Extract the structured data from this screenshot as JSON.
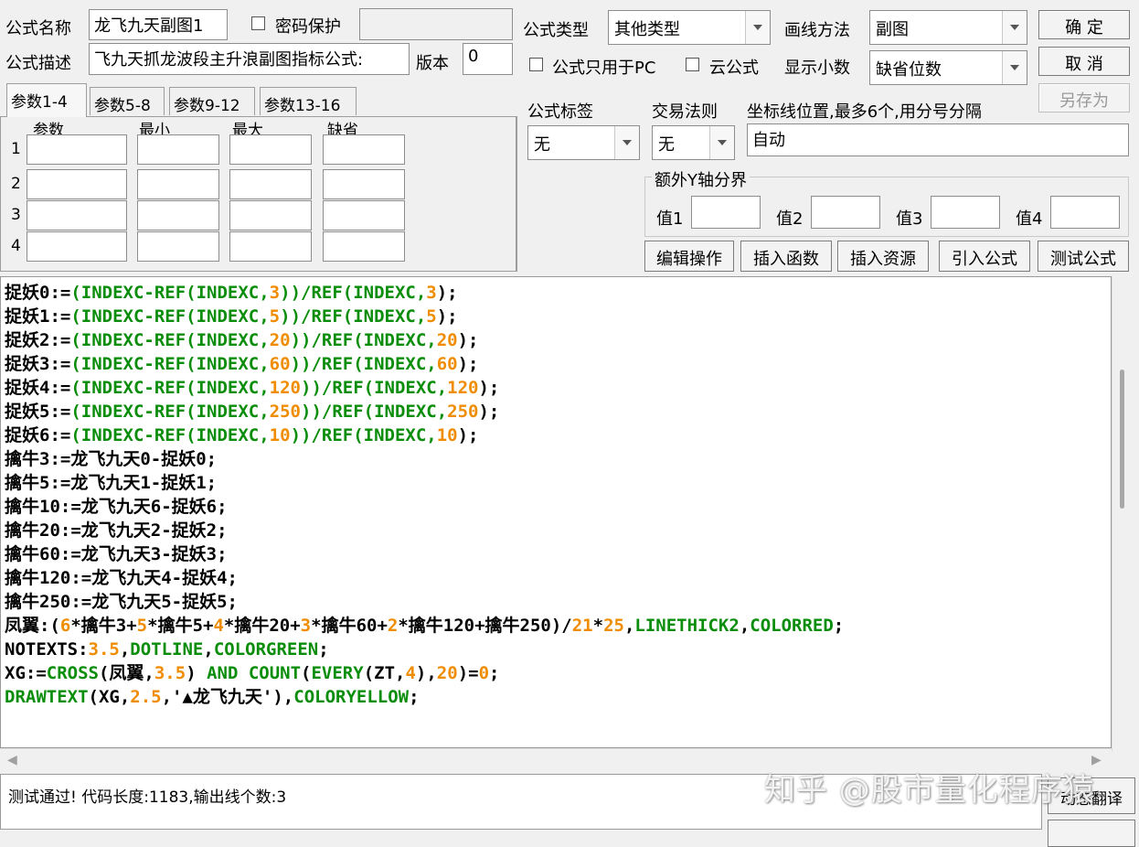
{
  "header": {
    "name_label": "公式名称",
    "name_value": "龙飞九天副图1",
    "password_label": "密码保护",
    "desc_label": "公式描述",
    "desc_value": "飞九天抓龙波段主升浪副图指标公式:",
    "version_label": "版本",
    "version_value": "0",
    "type_label": "公式类型",
    "type_value": "其他类型",
    "draw_label": "画线方法",
    "draw_value": "副图",
    "pc_only_label": "公式只用于PC",
    "cloud_label": "云公式",
    "decimals_label": "显示小数",
    "decimals_value": "缺省位数"
  },
  "buttons": {
    "ok": "确 定",
    "cancel": "取 消",
    "save_as": "另存为",
    "edit_ops": "编辑操作",
    "insert_func": "插入函数",
    "insert_res": "插入资源",
    "import_formula": "引入公式",
    "test_formula": "测试公式",
    "dynamic_translate": "动态翻译"
  },
  "tabs": [
    "参数1-4",
    "参数5-8",
    "参数9-12",
    "参数13-16"
  ],
  "param_headers": [
    "参数",
    "最小",
    "最大",
    "缺省"
  ],
  "param_rows": [
    "1",
    "2",
    "3",
    "4"
  ],
  "tag": {
    "label": "公式标签",
    "value": "无"
  },
  "trade_rule": {
    "label": "交易法则",
    "value": "无"
  },
  "axis": {
    "label": "坐标线位置,最多6个,用分号分隔",
    "value": "自动"
  },
  "extra_y": {
    "title": "额外Y轴分界",
    "labels": [
      "值1",
      "值2",
      "值3",
      "值4"
    ]
  },
  "code_lines": [
    [
      [
        "k",
        "捉妖0:="
      ],
      [
        "g",
        "(INDEXC-REF(INDEXC,"
      ],
      [
        "o",
        "3"
      ],
      [
        "g",
        "))/REF(INDEXC,"
      ],
      [
        "o",
        "3"
      ],
      [
        "k",
        ");"
      ]
    ],
    [
      [
        "k",
        "捉妖1:="
      ],
      [
        "g",
        "(INDEXC-REF(INDEXC,"
      ],
      [
        "o",
        "5"
      ],
      [
        "g",
        "))/REF(INDEXC,"
      ],
      [
        "o",
        "5"
      ],
      [
        "k",
        ");"
      ]
    ],
    [
      [
        "k",
        "捉妖2:="
      ],
      [
        "g",
        "(INDEXC-REF(INDEXC,"
      ],
      [
        "o",
        "20"
      ],
      [
        "g",
        "))/REF(INDEXC,"
      ],
      [
        "o",
        "20"
      ],
      [
        "k",
        ");"
      ]
    ],
    [
      [
        "k",
        "捉妖3:="
      ],
      [
        "g",
        "(INDEXC-REF(INDEXC,"
      ],
      [
        "o",
        "60"
      ],
      [
        "g",
        "))/REF(INDEXC,"
      ],
      [
        "o",
        "60"
      ],
      [
        "k",
        ");"
      ]
    ],
    [
      [
        "k",
        "捉妖4:="
      ],
      [
        "g",
        "(INDEXC-REF(INDEXC,"
      ],
      [
        "o",
        "120"
      ],
      [
        "g",
        "))/REF(INDEXC,"
      ],
      [
        "o",
        "120"
      ],
      [
        "k",
        ");"
      ]
    ],
    [
      [
        "k",
        "捉妖5:="
      ],
      [
        "g",
        "(INDEXC-REF(INDEXC,"
      ],
      [
        "o",
        "250"
      ],
      [
        "g",
        "))/REF(INDEXC,"
      ],
      [
        "o",
        "250"
      ],
      [
        "k",
        ");"
      ]
    ],
    [
      [
        "k",
        "捉妖6:="
      ],
      [
        "g",
        "(INDEXC-REF(INDEXC,"
      ],
      [
        "o",
        "10"
      ],
      [
        "g",
        "))/REF(INDEXC,"
      ],
      [
        "o",
        "10"
      ],
      [
        "k",
        ");"
      ]
    ],
    [
      [
        "k",
        "擒牛3:=龙飞九天0-捉妖0;"
      ]
    ],
    [
      [
        "k",
        "擒牛5:=龙飞九天1-捉妖1;"
      ]
    ],
    [
      [
        "k",
        "擒牛10:=龙飞九天6-捉妖6;"
      ]
    ],
    [
      [
        "k",
        "擒牛20:=龙飞九天2-捉妖2;"
      ]
    ],
    [
      [
        "k",
        "擒牛60:=龙飞九天3-捉妖3;"
      ]
    ],
    [
      [
        "k",
        "擒牛120:=龙飞九天4-捉妖4;"
      ]
    ],
    [
      [
        "k",
        "擒牛250:=龙飞九天5-捉妖5;"
      ]
    ],
    [
      [
        "k",
        "凤翼:("
      ],
      [
        "o",
        "6"
      ],
      [
        "k",
        "*擒牛3+"
      ],
      [
        "o",
        "5"
      ],
      [
        "k",
        "*擒牛5+"
      ],
      [
        "o",
        "4"
      ],
      [
        "k",
        "*擒牛20+"
      ],
      [
        "o",
        "3"
      ],
      [
        "k",
        "*擒牛60+"
      ],
      [
        "o",
        "2"
      ],
      [
        "k",
        "*擒牛120+擒牛250)/"
      ],
      [
        "o",
        "21"
      ],
      [
        "k",
        "*"
      ],
      [
        "o",
        "25"
      ],
      [
        "k",
        ","
      ],
      [
        "g",
        "LINETHICK2"
      ],
      [
        "k",
        ","
      ],
      [
        "g",
        "COLORRED"
      ],
      [
        "k",
        ";"
      ]
    ],
    [
      [
        "k",
        "NOTEXTS:"
      ],
      [
        "o",
        "3.5"
      ],
      [
        "k",
        ","
      ],
      [
        "g",
        "DOTLINE"
      ],
      [
        "k",
        ","
      ],
      [
        "g",
        "COLORGREEN"
      ],
      [
        "k",
        ";"
      ]
    ],
    [
      [
        "k",
        "XG:="
      ],
      [
        "g",
        "CROSS"
      ],
      [
        "k",
        "(凤翼,"
      ],
      [
        "o",
        "3.5"
      ],
      [
        "k",
        ") "
      ],
      [
        "g",
        "AND COUNT"
      ],
      [
        "k",
        "("
      ],
      [
        "g",
        "EVERY"
      ],
      [
        "k",
        "(ZT,"
      ],
      [
        "o",
        "4"
      ],
      [
        "k",
        "),"
      ],
      [
        "o",
        "20"
      ],
      [
        "k",
        ")="
      ],
      [
        "o",
        "0"
      ],
      [
        "k",
        ";"
      ]
    ],
    [
      [
        "g",
        "DRAWTEXT"
      ],
      [
        "k",
        "(XG,"
      ],
      [
        "o",
        "2.5"
      ],
      [
        "k",
        ",'▲龙飞九天'),"
      ],
      [
        "g",
        "COLORYELLOW"
      ],
      [
        "k",
        ";"
      ]
    ]
  ],
  "status_text": "测试通过! 代码长度:1183,输出线个数:3",
  "watermark": "知乎 @股市量化程序猿",
  "colors": {
    "code_green": "#0a8d0a",
    "code_orange": "#f08c00",
    "code_black": "#000000"
  }
}
